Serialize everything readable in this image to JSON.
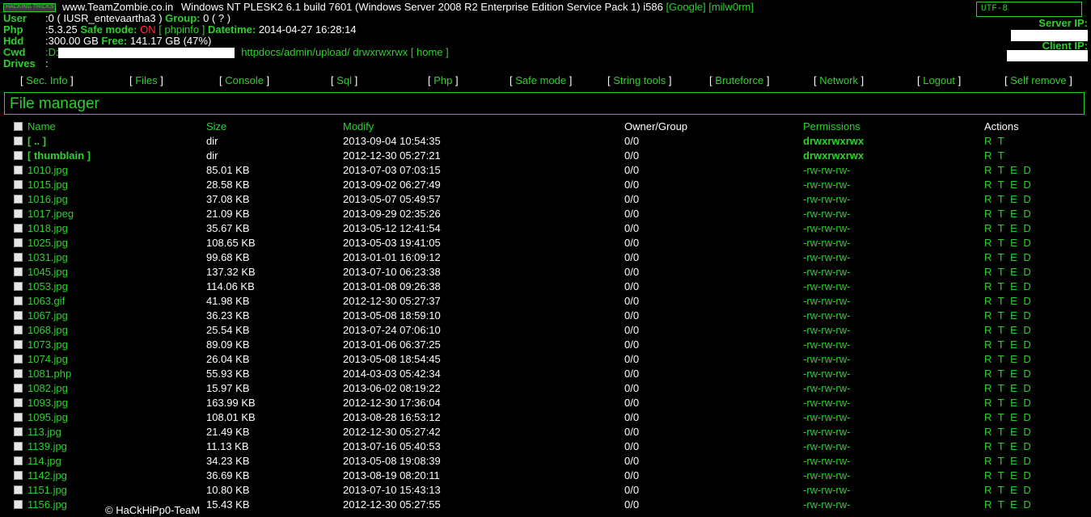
{
  "header": {
    "uname": {
      "badge": "HACKING TRICKS",
      "site": "www.TeamZombie.co.in",
      "text": "Windows NT PLESK2 6.1 build 7601 (Windows Server 2008 R2 Enterprise Edition Service Pack 1) i586",
      "google": "[Google]",
      "milw0rm": "[milw0rm]"
    },
    "user": {
      "key": "User",
      "value": ":0 ( IUSR_entevaartha3 )",
      "group_key": "Group:",
      "group_value": "0 ( ? )"
    },
    "php": {
      "key": "Php",
      "version": ":5.3.25",
      "safe_mode_key": "Safe mode:",
      "safe_mode_value": "ON",
      "phpinfo": "[ phpinfo ]",
      "datetime_key": "Datetime:",
      "datetime_value": "2014-04-27 16:28:14"
    },
    "hdd": {
      "key": "Hdd",
      "total": ":300.00 GB",
      "free_key": "Free:",
      "free_value": "141.17 GB (47%)"
    },
    "cwd": {
      "key": "Cwd",
      "prefix": ":D:",
      "path": "httpdocs/admin/upload/",
      "perms": "drwxrwxrwx",
      "home": "[ home ]"
    },
    "drives": {
      "key": "Drives",
      "value": ":"
    },
    "charset": "UTF-8",
    "server_ip_label": "Server IP:",
    "client_ip_label": "Client IP:"
  },
  "menu": [
    {
      "label": "Sec. Info"
    },
    {
      "label": "Files"
    },
    {
      "label": "Console"
    },
    {
      "label": "Sql"
    },
    {
      "label": "Php"
    },
    {
      "label": "Safe mode"
    },
    {
      "label": "String tools"
    },
    {
      "label": "Bruteforce"
    },
    {
      "label": "Network"
    },
    {
      "label": "Logout"
    },
    {
      "label": "Self remove"
    }
  ],
  "file_manager": {
    "title": "File manager",
    "columns": {
      "name": "Name",
      "size": "Size",
      "modify": "Modify",
      "owner": "Owner/Group",
      "permissions": "Permissions",
      "actions": "Actions"
    },
    "rows": [
      {
        "name": "[ .. ]",
        "size": "dir",
        "modify": "2013-09-04 10:54:35",
        "owner": "0/0",
        "perms": "drwxrwxrwx",
        "actions": "R T",
        "dir": true
      },
      {
        "name": "[ thumblain ]",
        "size": "dir",
        "modify": "2012-12-30 05:27:21",
        "owner": "0/0",
        "perms": "drwxrwxrwx",
        "actions": "R T",
        "dir": true
      },
      {
        "name": "1010.jpg",
        "size": "85.01 KB",
        "modify": "2013-07-03 07:03:15",
        "owner": "0/0",
        "perms": "-rw-rw-rw-",
        "actions": "R T E D"
      },
      {
        "name": "1015.jpg",
        "size": "28.58 KB",
        "modify": "2013-09-02 06:27:49",
        "owner": "0/0",
        "perms": "-rw-rw-rw-",
        "actions": "R T E D"
      },
      {
        "name": "1016.jpg",
        "size": "37.08 KB",
        "modify": "2013-05-07 05:49:57",
        "owner": "0/0",
        "perms": "-rw-rw-rw-",
        "actions": "R T E D"
      },
      {
        "name": "1017.jpeg",
        "size": "21.09 KB",
        "modify": "2013-09-29 02:35:26",
        "owner": "0/0",
        "perms": "-rw-rw-rw-",
        "actions": "R T E D"
      },
      {
        "name": "1018.jpg",
        "size": "35.67 KB",
        "modify": "2013-05-12 12:41:54",
        "owner": "0/0",
        "perms": "-rw-rw-rw-",
        "actions": "R T E D"
      },
      {
        "name": "1025.jpg",
        "size": "108.65 KB",
        "modify": "2013-05-03 19:41:05",
        "owner": "0/0",
        "perms": "-rw-rw-rw-",
        "actions": "R T E D"
      },
      {
        "name": "1031.jpg",
        "size": "99.68 KB",
        "modify": "2013-01-01 16:09:12",
        "owner": "0/0",
        "perms": "-rw-rw-rw-",
        "actions": "R T E D"
      },
      {
        "name": "1045.jpg",
        "size": "137.32 KB",
        "modify": "2013-07-10 06:23:38",
        "owner": "0/0",
        "perms": "-rw-rw-rw-",
        "actions": "R T E D"
      },
      {
        "name": "1053.jpg",
        "size": "114.06 KB",
        "modify": "2013-01-08 09:26:38",
        "owner": "0/0",
        "perms": "-rw-rw-rw-",
        "actions": "R T E D"
      },
      {
        "name": "1063.gif",
        "size": "41.98 KB",
        "modify": "2012-12-30 05:27:37",
        "owner": "0/0",
        "perms": "-rw-rw-rw-",
        "actions": "R T E D"
      },
      {
        "name": "1067.jpg",
        "size": "36.23 KB",
        "modify": "2013-05-08 18:59:10",
        "owner": "0/0",
        "perms": "-rw-rw-rw-",
        "actions": "R T E D"
      },
      {
        "name": "1068.jpg",
        "size": "25.54 KB",
        "modify": "2013-07-24 07:06:10",
        "owner": "0/0",
        "perms": "-rw-rw-rw-",
        "actions": "R T E D"
      },
      {
        "name": "1073.jpg",
        "size": "89.09 KB",
        "modify": "2013-01-06 06:37:25",
        "owner": "0/0",
        "perms": "-rw-rw-rw-",
        "actions": "R T E D"
      },
      {
        "name": "1074.jpg",
        "size": "26.04 KB",
        "modify": "2013-05-08 18:54:45",
        "owner": "0/0",
        "perms": "-rw-rw-rw-",
        "actions": "R T E D"
      },
      {
        "name": "1081.php",
        "size": "55.93 KB",
        "modify": "2014-03-03 05:42:34",
        "owner": "0/0",
        "perms": "-rw-rw-rw-",
        "actions": "R T E D"
      },
      {
        "name": "1082.jpg",
        "size": "15.97 KB",
        "modify": "2013-06-02 08:19:22",
        "owner": "0/0",
        "perms": "-rw-rw-rw-",
        "actions": "R T E D"
      },
      {
        "name": "1093.jpg",
        "size": "163.99 KB",
        "modify": "2012-12-30 17:36:04",
        "owner": "0/0",
        "perms": "-rw-rw-rw-",
        "actions": "R T E D"
      },
      {
        "name": "1095.jpg",
        "size": "108.01 KB",
        "modify": "2013-08-28 16:53:12",
        "owner": "0/0",
        "perms": "-rw-rw-rw-",
        "actions": "R T E D"
      },
      {
        "name": "113.jpg",
        "size": "21.49 KB",
        "modify": "2012-12-30 05:27:42",
        "owner": "0/0",
        "perms": "-rw-rw-rw-",
        "actions": "R T E D"
      },
      {
        "name": "1139.jpg",
        "size": "11.13 KB",
        "modify": "2013-07-16 05:40:53",
        "owner": "0/0",
        "perms": "-rw-rw-rw-",
        "actions": "R T E D"
      },
      {
        "name": "114.jpg",
        "size": "34.23 KB",
        "modify": "2013-05-08 19:08:39",
        "owner": "0/0",
        "perms": "-rw-rw-rw-",
        "actions": "R T E D"
      },
      {
        "name": "1142.jpg",
        "size": "36.69 KB",
        "modify": "2013-08-19 08:20:11",
        "owner": "0/0",
        "perms": "-rw-rw-rw-",
        "actions": "R T E D"
      },
      {
        "name": "1151.jpg",
        "size": "10.80 KB",
        "modify": "2013-07-10 15:43:13",
        "owner": "0/0",
        "perms": "-rw-rw-rw-",
        "actions": "R T E D"
      },
      {
        "name": "1156.jpg",
        "size": "15.43 KB",
        "modify": "2012-12-30 05:27:55",
        "owner": "0/0",
        "perms": "-rw-rw-rw-",
        "actions": "R T E D"
      }
    ]
  },
  "footer": "© HaCkHiPp0-TeaM"
}
